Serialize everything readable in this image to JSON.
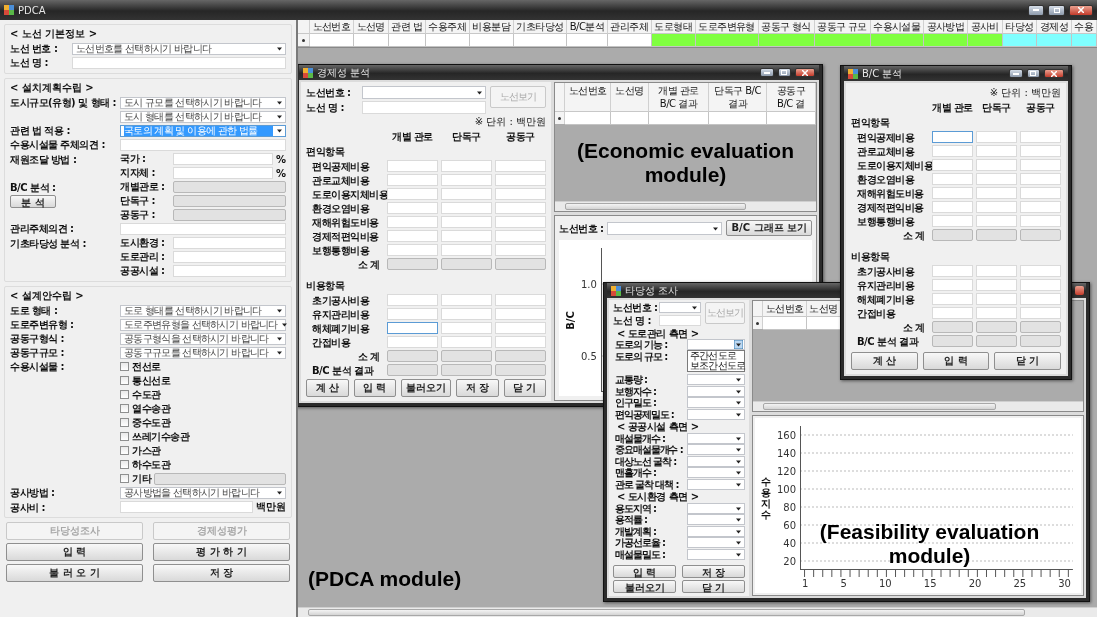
{
  "window": {
    "title": "PDCA"
  },
  "pdca": {
    "groups": [
      {
        "title": "< 노선 기본정보 >",
        "rows": [
          {
            "kind": "select",
            "label": "노선 번호 :",
            "value": "노선번호를 선택하시기 바랍니다",
            "highlighted": false
          },
          {
            "kind": "text",
            "label": "노선 명 :",
            "disabled": false
          }
        ]
      },
      {
        "title": "< 설치계획수립 >",
        "rows": [
          {
            "kind": "select",
            "label": "도시규모(유형) 및 형태 :",
            "value": "도시 규모를 선택하시기 바랍니다",
            "highlighted": false
          },
          {
            "kind": "select",
            "value": "도시 형태를 선택하시기 바랍니다",
            "highlighted": false
          },
          {
            "kind": "select",
            "label": "관련 법 적용 :",
            "value": "국토의 계획 및 이용에 관한 법률",
            "highlighted": true
          },
          {
            "kind": "text",
            "label": "수용시설물 주체의견 :",
            "disabled": false
          },
          {
            "kind": "text",
            "label": "재원조달 방법 :",
            "sublabel": "국가 :",
            "unit": "%",
            "disabled": false
          },
          {
            "kind": "text",
            "sublabel": "지자체 :",
            "unit": "%",
            "disabled": false
          },
          {
            "kind": "text",
            "label": "B/C 분석 :",
            "sublabel": "개별관로 :",
            "disabled": true
          },
          {
            "kind": "text",
            "button": "분 석",
            "sublabel": "단독구 :",
            "disabled": true
          },
          {
            "kind": "text",
            "sublabel": "공동구 :",
            "disabled": true
          },
          {
            "kind": "text",
            "label": "관리주체의견 :",
            "disabled": false
          },
          {
            "kind": "text",
            "label": "기초타당성 분석 :",
            "sublabel": "도시환경 :",
            "disabled": false
          },
          {
            "kind": "text",
            "sublabel": "도로관리 :",
            "disabled": false
          },
          {
            "kind": "text",
            "sublabel": "공공시설 :",
            "disabled": false
          }
        ]
      },
      {
        "title": "< 설계안수립 >",
        "rows": [
          {
            "kind": "select",
            "label": "도로 형태 :",
            "value": "도로 형태를 선택하시기 바랍니다",
            "highlighted": false
          },
          {
            "kind": "select",
            "label": "도로주변유형 :",
            "value": "도로주변유형을 선택하시기 바랍니다",
            "highlighted": false
          },
          {
            "kind": "select",
            "label": "공동구형식 :",
            "value": "공동구형식을 선택하시기 바랍니다",
            "highlighted": false
          },
          {
            "kind": "select",
            "label": "공동구규모 :",
            "value": "공동구규모를 선택하시기 바랍니다",
            "highlighted": false
          },
          {
            "kind": "checkbox",
            "label": "수용시설물 :",
            "text": "전선로",
            "checked": false
          },
          {
            "kind": "checkbox",
            "text": "통신선로",
            "checked": false
          },
          {
            "kind": "checkbox",
            "text": "수도관",
            "checked": false
          },
          {
            "kind": "checkbox",
            "text": "열수송관",
            "checked": false
          },
          {
            "kind": "checkbox",
            "text": "중수도관",
            "checked": false
          },
          {
            "kind": "checkbox",
            "text": "쓰레기수송관",
            "checked": false
          },
          {
            "kind": "checkbox",
            "text": "가스관",
            "checked": false
          },
          {
            "kind": "checkbox",
            "text": "하수도관",
            "checked": false
          },
          {
            "kind": "checkbox_field",
            "text": "기타",
            "checked": false
          },
          {
            "kind": "select",
            "label": "공사방법 :",
            "value": "공사방법을 선택하시기 바랍니다",
            "highlighted": false
          },
          {
            "kind": "text",
            "label": "공사비 :",
            "unit": "백만원",
            "disabled": false
          }
        ]
      }
    ],
    "buttons": [
      {
        "label": "타당성조사",
        "disabled": true
      },
      {
        "label": "경제성평가",
        "disabled": true
      },
      {
        "label": "입 력",
        "disabled": false
      },
      {
        "label": "평 가 하 기",
        "disabled": false
      },
      {
        "label": "불 러 오 기",
        "disabled": false
      },
      {
        "label": "저 장",
        "disabled": false
      }
    ],
    "caption": "(PDCA module)"
  },
  "summary_table": {
    "columns": [
      {
        "header": "노선번호",
        "color": "#ffffff"
      },
      {
        "header": "노선명",
        "color": "#ffffff"
      },
      {
        "header": "관련 법",
        "color": "#ffffff"
      },
      {
        "header": "수용주체",
        "color": "#ffffff"
      },
      {
        "header": "비용분담",
        "color": "#ffffff"
      },
      {
        "header": "기초타당성",
        "color": "#ffffff"
      },
      {
        "header": "B/C분석",
        "color": "#ffffff"
      },
      {
        "header": "관리주체",
        "color": "#ffffff"
      },
      {
        "header": "도로형태",
        "color": "#80ff40"
      },
      {
        "header": "도로주변유형",
        "color": "#80ff40"
      },
      {
        "header": "공동구 형식",
        "color": "#80ff40"
      },
      {
        "header": "공동구 규모",
        "color": "#80ff40"
      },
      {
        "header": "수용시설물",
        "color": "#80ff40"
      },
      {
        "header": "공사방법",
        "color": "#80ff40"
      },
      {
        "header": "공사비",
        "color": "#80ff40"
      },
      {
        "header": "타당성",
        "color": "#80ffff"
      },
      {
        "header": "경제성",
        "color": "#80ffff"
      },
      {
        "header": "수용",
        "color": "#80ffff"
      }
    ]
  },
  "economic_window": {
    "title": "경제성 분석",
    "route_label": "노선번호 :",
    "route_name_label": "노선 명 :",
    "view_button": {
      "label": "노선보기",
      "disabled": true
    },
    "costs": {
      "unit_note": "※ 단위 : 백만원",
      "columns": [
        "개별 관로",
        "단독구",
        "공동구"
      ],
      "benefit_title": "편익항목",
      "benefits": [
        {
          "kind": "item",
          "label": "편익공제비용",
          "focused": false
        },
        {
          "kind": "item",
          "label": "관로교체비용",
          "focused": false
        },
        {
          "kind": "item",
          "label": "도로이용지체비용",
          "focused": false
        },
        {
          "kind": "item",
          "label": "환경오염비용",
          "focused": false
        },
        {
          "kind": "item",
          "label": "재해위험도비용",
          "focused": false
        },
        {
          "kind": "item",
          "label": "경제적편익비용",
          "focused": false
        },
        {
          "kind": "item",
          "label": "보행통행비용",
          "focused": false
        },
        {
          "kind": "total",
          "label": "소 계",
          "focused": false
        }
      ],
      "cost_title": "비용항목",
      "items": [
        {
          "kind": "item",
          "label": "초기공사비용",
          "focused": false
        },
        {
          "kind": "item",
          "label": "유지관리비용",
          "focused": false
        },
        {
          "kind": "item",
          "label": "해체폐기비용",
          "focused": true
        },
        {
          "kind": "item",
          "label": "간접비용",
          "focused": false
        },
        {
          "kind": "total",
          "label": "소 계",
          "focused": false
        },
        {
          "kind": "result",
          "label": "B/C 분석 결과",
          "focused": false
        }
      ]
    },
    "buttons": [
      "계 산",
      "입 력",
      "불러오기",
      "저 장",
      "닫 기"
    ],
    "result_table": {
      "columns": [
        "노선번호",
        "노선명",
        "개별 관로 B/C 결과",
        "단독구 B/C 결과",
        "공동구 B/C 결"
      ]
    },
    "caption": "(Economic evaluation module)",
    "chart_panel": {
      "route_label": "노선번호 :",
      "graph_button": "B/C 그래프 보기",
      "y_label": "B/C",
      "y_ticks": [
        "1.0",
        "0.5"
      ]
    }
  },
  "feasibility_window": {
    "title": "타당성 조사",
    "route_label": "노선번호 :",
    "route_name_label": "노선 명 :",
    "view_button": {
      "label": "노선보기",
      "disabled": true
    },
    "sections": [
      {
        "title": "< 도로관리 측면 >",
        "rows": [
          {
            "label": "도로의 기능 :",
            "expanded": true,
            "options": [
              "주간선도로",
              "보조간선도로"
            ]
          },
          {
            "label": "도로의 규모 :",
            "expanded": false
          },
          {
            "label": "교통량 :",
            "expanded": false
          },
          {
            "label": "보행자수 :",
            "expanded": false
          },
          {
            "label": "인구밀도 :",
            "expanded": false
          },
          {
            "label": "편익공제밀도 :",
            "expanded": false
          }
        ]
      },
      {
        "title": "< 공공시설 측면 >",
        "rows": [
          {
            "label": "매설물개수 :",
            "expanded": false
          },
          {
            "label": "중요매설물개수 :",
            "expanded": false
          },
          {
            "label": "대상노선 굴착 :",
            "expanded": false
          },
          {
            "label": "맨홀개수 :",
            "expanded": false
          },
          {
            "label": "관로 굴착 대책 :",
            "expanded": false
          }
        ]
      },
      {
        "title": "< 도시환경 측면 >",
        "rows": [
          {
            "label": "용도지역 :",
            "expanded": false
          },
          {
            "label": "용적률 :",
            "expanded": false
          },
          {
            "label": "개발계획 :",
            "expanded": false
          },
          {
            "label": "가공선로율 :",
            "expanded": false
          },
          {
            "label": "매설물밀도 :",
            "expanded": false
          }
        ]
      }
    ],
    "buttons": [
      "입 력",
      "저 장",
      "불러오기",
      "닫 기"
    ],
    "result_table": {
      "columns": [
        "노선번호",
        "노선명"
      ]
    },
    "chart": {
      "y_label": "수용지수",
      "y_ticks": [
        "160",
        "140",
        "120",
        "100",
        "80",
        "60",
        "40",
        "20"
      ],
      "x_ticks": [
        "1",
        "5",
        "10",
        "15",
        "20",
        "25",
        "30"
      ]
    },
    "caption": "(Feasibility evaluation module)"
  },
  "bc_window": {
    "title": "B/C 분석",
    "costs": {
      "unit_note": "※ 단위 : 백만원",
      "columns": [
        "개별 관로",
        "단독구",
        "공동구"
      ],
      "benefit_title": "편익항목",
      "benefits": [
        {
          "kind": "item",
          "label": "편익공제비용",
          "focused": true
        },
        {
          "kind": "item",
          "label": "관로교체비용",
          "focused": false
        },
        {
          "kind": "item",
          "label": "도로이용지체비용",
          "focused": false
        },
        {
          "kind": "item",
          "label": "환경오염비용",
          "focused": false
        },
        {
          "kind": "item",
          "label": "재해위험도비용",
          "focused": false
        },
        {
          "kind": "item",
          "label": "경제적편익비용",
          "focused": false
        },
        {
          "kind": "item",
          "label": "보행통행비용",
          "focused": false
        },
        {
          "kind": "total",
          "label": "소 계",
          "focused": false
        }
      ],
      "cost_title": "비용항목",
      "items": [
        {
          "kind": "item",
          "label": "초기공사비용",
          "focused": false
        },
        {
          "kind": "item",
          "label": "유지관리비용",
          "focused": false
        },
        {
          "kind": "item",
          "label": "해체폐기비용",
          "focused": false
        },
        {
          "kind": "item",
          "label": "간접비용",
          "focused": false
        },
        {
          "kind": "total",
          "label": "소 계",
          "focused": false
        },
        {
          "kind": "result",
          "label": "B/C 분석 결과",
          "focused": false
        }
      ]
    },
    "buttons": [
      "계 산",
      "입 력",
      "닫 기"
    ]
  }
}
